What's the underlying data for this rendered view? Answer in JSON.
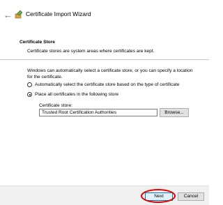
{
  "window": {
    "title": "Certificate Import Wizard",
    "back_icon": "back-arrow-icon",
    "app_icon": "certificate-wizard-icon"
  },
  "header": {
    "title": "Certificate Store",
    "description": "Certificate stores are system areas where certificates are kept."
  },
  "body": {
    "intro": "Windows can automatically select a certificate store, or you can specify a location for the certificate.",
    "options": [
      {
        "label": "Automatically select the certificate store based on the type of certificate",
        "checked": false
      },
      {
        "label": "Place all certificates in the following store",
        "checked": true
      }
    ],
    "store_label": "Certificate store:",
    "store_value": "Trusted Root Certification Authorities",
    "browse_label": "Browse..."
  },
  "footer": {
    "next_label": "Next",
    "cancel_label": "Cancel",
    "highlight_color": "#e00000"
  }
}
